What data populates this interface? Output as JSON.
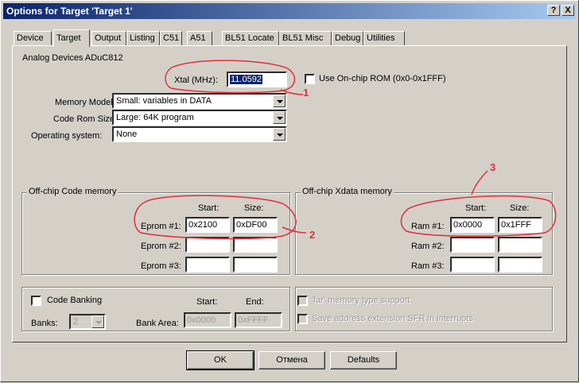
{
  "window": {
    "title": "Options for Target 'Target 1'",
    "help_btn": "?",
    "close_btn": "X"
  },
  "tabs": [
    "Device",
    "Target",
    "Output",
    "Listing",
    "C51",
    "A51",
    "BL51 Locate",
    "BL51 Misc",
    "Debug",
    "Utilities"
  ],
  "device_name": "Analog Devices ADuC812",
  "xtal": {
    "label": "Xtal (MHz):",
    "value": "11.0592"
  },
  "onchip_rom": {
    "label": "Use On-chip ROM (0x0-0x1FFF)"
  },
  "memory_model": {
    "label": "Memory Model:",
    "value": "Small: variables in DATA"
  },
  "code_rom_size": {
    "label": "Code Rom Size:",
    "value": "Large: 64K program"
  },
  "os": {
    "label": "Operating system:",
    "value": "None"
  },
  "code_mem": {
    "title": "Off-chip Code memory",
    "start_hdr": "Start:",
    "size_hdr": "Size:",
    "rows": [
      {
        "label": "Eprom #1:",
        "start": "0x2100",
        "size": "0xDF00"
      },
      {
        "label": "Eprom #2:",
        "start": "",
        "size": ""
      },
      {
        "label": "Eprom #3:",
        "start": "",
        "size": ""
      }
    ]
  },
  "xdata_mem": {
    "title": "Off-chip Xdata memory",
    "start_hdr": "Start:",
    "size_hdr": "Size:",
    "rows": [
      {
        "label": "Ram #1:",
        "start": "0x0000",
        "size": "0x1FFF"
      },
      {
        "label": "Ram #2:",
        "start": "",
        "size": ""
      },
      {
        "label": "Ram #3:",
        "start": "",
        "size": ""
      }
    ]
  },
  "banking": {
    "label": "Code Banking",
    "banks_label": "Banks:",
    "banks_value": "2",
    "start_hdr": "Start:",
    "end_hdr": "End:",
    "area_label": "Bank Area:",
    "area_start": "0x0000",
    "area_end": "0xFFFF"
  },
  "far_support": "'far' memory type support",
  "save_ext": "Save address extension SFR in interrupts",
  "buttons": {
    "ok": "OK",
    "cancel": "Отмена",
    "defaults": "Defaults"
  },
  "annotations": [
    "1",
    "2",
    "3"
  ],
  "colors": {
    "annotation": "#e0303a",
    "titlebar": "#0a246a"
  }
}
